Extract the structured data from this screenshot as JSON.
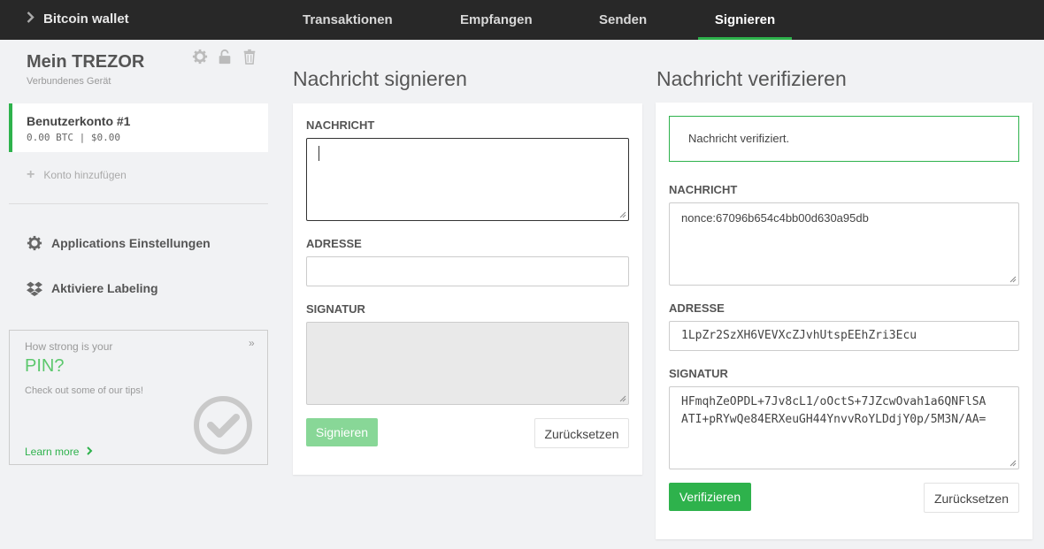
{
  "topbar": {
    "brand": "Bitcoin wallet",
    "tabs": [
      {
        "label": "Transaktionen",
        "active": false
      },
      {
        "label": "Empfangen",
        "active": false
      },
      {
        "label": "Senden",
        "active": false
      },
      {
        "label": "Signieren",
        "active": true
      }
    ]
  },
  "sidebar": {
    "device_title": "Mein TREZOR",
    "device_subtitle": "Verbundenes Gerät",
    "account": {
      "name": "Benutzerkonto #1",
      "balance": "0.00 BTC | $0.00"
    },
    "add_account": "Konto hinzufügen",
    "items": [
      {
        "label": "Applications Einstellungen",
        "icon": "gear-icon"
      },
      {
        "label": "Aktiviere Labeling",
        "icon": "dropbox-icon"
      }
    ],
    "pin_box": {
      "question": "How strong is your",
      "pin": "PIN?",
      "tips": "Check out some of our tips!",
      "close": "»",
      "learn_more": "Learn more"
    }
  },
  "sign": {
    "title": "Nachricht signieren",
    "message_label": "NACHRICHT",
    "message_value": "",
    "address_label": "ADRESSE",
    "address_value": "",
    "signature_label": "SIGNATUR",
    "signature_value": "",
    "sign_button": "Signieren",
    "reset_button": "Zurücksetzen"
  },
  "verify": {
    "title": "Nachricht verifizieren",
    "success_message": "Nachricht verifiziert.",
    "message_label": "NACHRICHT",
    "message_value": "nonce:67096b654c4bb00d630a95db",
    "address_label": "ADRESSE",
    "address_value": "1LpZr2SzXH6VEVXcZJvhUtspEEhZri3Ecu",
    "signature_label": "SIGNATUR",
    "signature_line1": "HFmqhZeOPDL+7Jv8cL1/oOctS+7JZcwOvah1a6QNFlSA",
    "signature_line2": "ATI+pRYwQe84ERXeuGH44YnvvRoYLDdjY0p/5M3N/AA=",
    "verify_button": "Verifizieren",
    "reset_button": "Zurücksetzen"
  },
  "colors": {
    "accent": "#2eb24c",
    "topbar": "#282828"
  }
}
